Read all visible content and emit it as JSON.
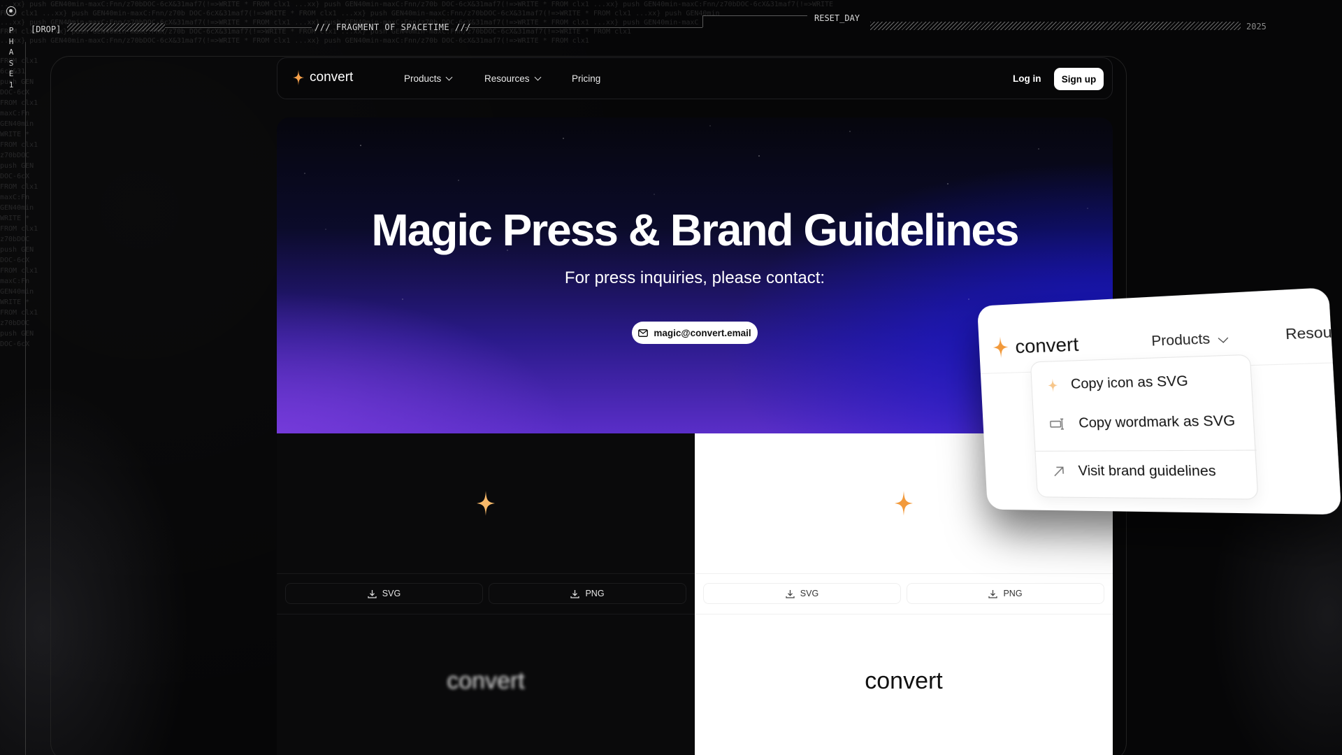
{
  "hud": {
    "phase_letters": [
      "P",
      "H",
      "A",
      "S",
      "E",
      "1"
    ],
    "drop_label": "[DROP]",
    "fragment_label": "/// FRAGMENT OF SPACETIME ///",
    "reset_label": "RESET_DAY",
    "year": "2025"
  },
  "nav": {
    "brand": "convert",
    "items": [
      {
        "label": "Products",
        "has_menu": true
      },
      {
        "label": "Resources",
        "has_menu": true
      },
      {
        "label": "Pricing",
        "has_menu": false
      }
    ],
    "login": "Log in",
    "signup": "Sign up"
  },
  "hero": {
    "title": "Magic Press & Brand Guidelines",
    "subtitle": "For press inquiries, please contact:",
    "email": "magic@convert.email"
  },
  "assets": {
    "dark": {
      "svg_label": "SVG",
      "png_label": "PNG",
      "wordmark": "convert"
    },
    "light": {
      "svg_label": "SVG",
      "png_label": "PNG",
      "wordmark": "convert"
    }
  },
  "floating_menu": {
    "brand": "convert",
    "products_label": "Products",
    "resources_label": "Resou",
    "items": [
      {
        "label": "Copy icon as SVG",
        "icon": "sparkle-icon"
      },
      {
        "label": "Copy wordmark as SVG",
        "icon": "wordmark-icon"
      },
      {
        "label": "Visit brand guidelines",
        "icon": "arrow-up-right-icon"
      }
    ]
  },
  "colors": {
    "accent": "#f5a04a",
    "hero_blue": "#1414d2",
    "hero_purple": "#5a2ec8"
  }
}
